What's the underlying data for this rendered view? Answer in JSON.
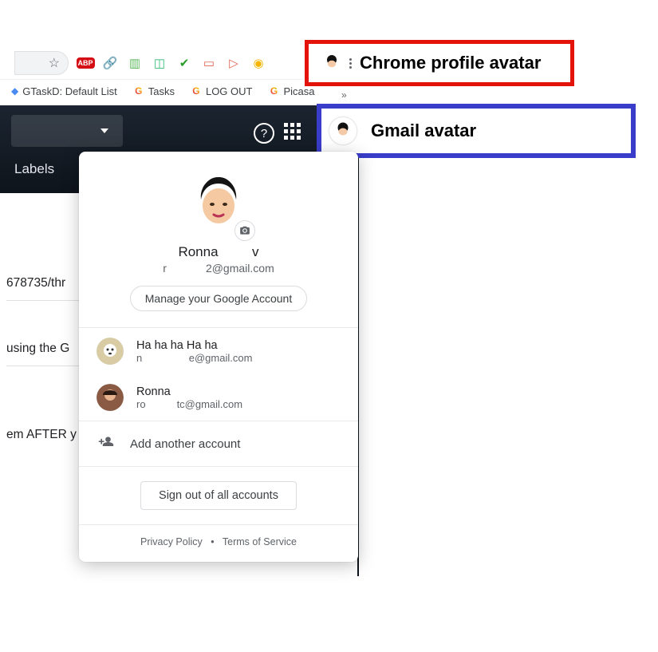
{
  "annotations": {
    "chrome_profile_label": "Chrome profile avatar",
    "gmail_avatar_label": "Gmail avatar"
  },
  "bookmarks": {
    "items": [
      {
        "icon_text": "",
        "label": "GTaskD: Default List"
      },
      {
        "icon_text": "G",
        "label": "Tasks"
      },
      {
        "icon_text": "G",
        "label": "LOG OUT"
      },
      {
        "icon_text": "G",
        "label": "Picasa"
      }
    ],
    "overflow_glyph": "»"
  },
  "gmail": {
    "labels_tab": "Labels"
  },
  "background_text": {
    "line1": "678735/thr",
    "line2": "using the G",
    "line3": "em AFTER y"
  },
  "popup": {
    "name_first": "Ronna",
    "name_suffix": "v",
    "email_prefix": "r",
    "email_suffix": "2@gmail.com",
    "manage_label": "Manage your Google Account",
    "accounts": [
      {
        "name": "Ha ha ha Ha ha",
        "email_prefix": "n",
        "email_suffix": "e@gmail.com"
      },
      {
        "name": "Ronna",
        "email_prefix": "ro",
        "email_suffix": "tc@gmail.com"
      }
    ],
    "add_label": "Add another account",
    "signout_label": "Sign out of all accounts",
    "privacy_label": "Privacy Policy",
    "terms_label": "Terms of Service"
  }
}
